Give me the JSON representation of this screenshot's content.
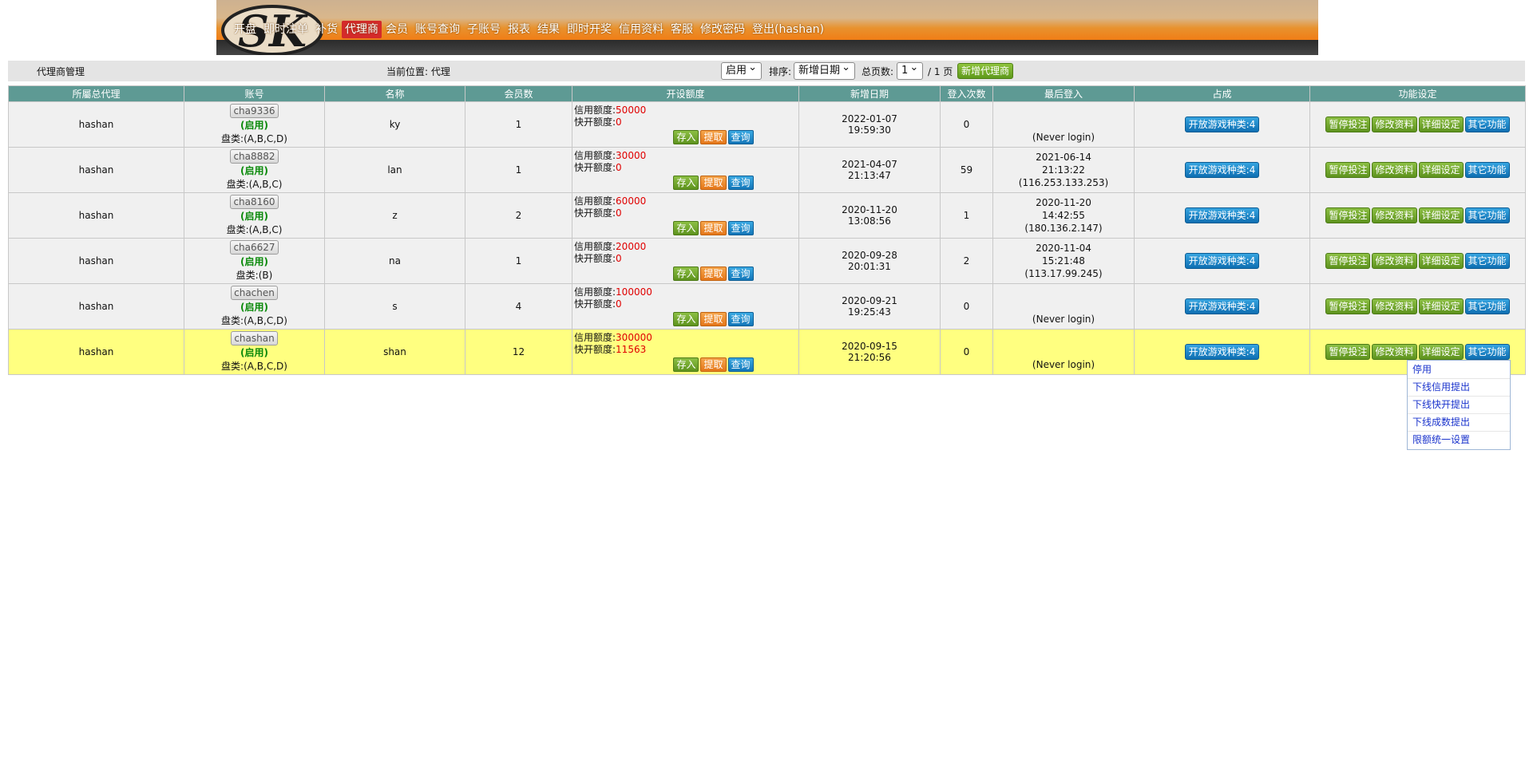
{
  "nav": {
    "logo_text": "SK",
    "items": [
      "开盘",
      "即时注单",
      "补货",
      "代理商",
      "会员",
      "账号查询",
      "子账号",
      "报表",
      "结果",
      "即时开奖",
      "信用资料",
      "客服",
      "修改密码",
      "登出(hashan)"
    ],
    "active": "代理商"
  },
  "toolbar": {
    "section_title": "代理商管理",
    "location": "当前位置: 代理",
    "status_select": "启用",
    "sort_label": "排序:",
    "sort_select": "新增日期",
    "pages_label": "总页数:",
    "page_select": "1",
    "page_suffix": "/ 1 页",
    "new_button": "新增代理商"
  },
  "table": {
    "headers": [
      "所屬总代理",
      "账号",
      "名称",
      "会员数",
      "开设额度",
      "新增日期",
      "登入次数",
      "最后登入",
      "占成",
      "功能设定"
    ],
    "labels": {
      "credit": "信用额度:",
      "quick": "快开额度:",
      "deposit": "存入",
      "withdraw": "提取",
      "query": "查询",
      "games": "开放游戏种类:4",
      "suspend": "暂停投注",
      "edit": "修改资料",
      "detail": "详细设定",
      "other": "其它功能"
    },
    "rows": [
      {
        "parent": "hashan",
        "account": "cha9336",
        "status": "(启用)",
        "pan": "盘类:(A,B,C,D)",
        "name": "ky",
        "members": "1",
        "credit": "50000",
        "quick": "0",
        "date": "2022-01-07",
        "time": "19:59:30",
        "logins": "0",
        "last_date": "",
        "last_time": "",
        "last_ip": "(Never login)"
      },
      {
        "parent": "hashan",
        "account": "cha8882",
        "status": "(启用)",
        "pan": "盘类:(A,B,C)",
        "name": "lan",
        "members": "1",
        "credit": "30000",
        "quick": "0",
        "date": "2021-04-07",
        "time": "21:13:47",
        "logins": "59",
        "last_date": "2021-06-14",
        "last_time": "21:13:22",
        "last_ip": "(116.253.133.253)"
      },
      {
        "parent": "hashan",
        "account": "cha8160",
        "status": "(启用)",
        "pan": "盘类:(A,B,C)",
        "name": "z",
        "members": "2",
        "credit": "60000",
        "quick": "0",
        "date": "2020-11-20",
        "time": "13:08:56",
        "logins": "1",
        "last_date": "2020-11-20",
        "last_time": "14:42:55",
        "last_ip": "(180.136.2.147)"
      },
      {
        "parent": "hashan",
        "account": "cha6627",
        "status": "(启用)",
        "pan": "盘类:(B)",
        "name": "na",
        "members": "1",
        "credit": "20000",
        "quick": "0",
        "date": "2020-09-28",
        "time": "20:01:31",
        "logins": "2",
        "last_date": "2020-11-04",
        "last_time": "15:21:48",
        "last_ip": "(113.17.99.245)"
      },
      {
        "parent": "hashan",
        "account": "chachen",
        "status": "(启用)",
        "pan": "盘类:(A,B,C,D)",
        "name": "s",
        "members": "4",
        "credit": "100000",
        "quick": "0",
        "date": "2020-09-21",
        "time": "19:25:43",
        "logins": "0",
        "last_date": "",
        "last_time": "",
        "last_ip": "(Never login)"
      },
      {
        "parent": "hashan",
        "account": "chashan",
        "status": "(启用)",
        "pan": "盘类:(A,B,C,D)",
        "name": "shan",
        "members": "12",
        "credit": "300000",
        "quick": "11563",
        "date": "2020-09-15",
        "time": "21:20:56",
        "logins": "0",
        "last_date": "",
        "last_time": "",
        "last_ip": "(Never login)"
      }
    ]
  },
  "dropdown": {
    "items": [
      "停用",
      "下线信用提出",
      "下线快开提出",
      "下线成数提出",
      "限额统一设置"
    ]
  },
  "colors": {
    "header_teal": "#5e9a94",
    "highlight_row": "#ffff80",
    "nav_active": "#d42a2a",
    "credit_value": "#e00000",
    "status_green": "#0b8a0b"
  }
}
